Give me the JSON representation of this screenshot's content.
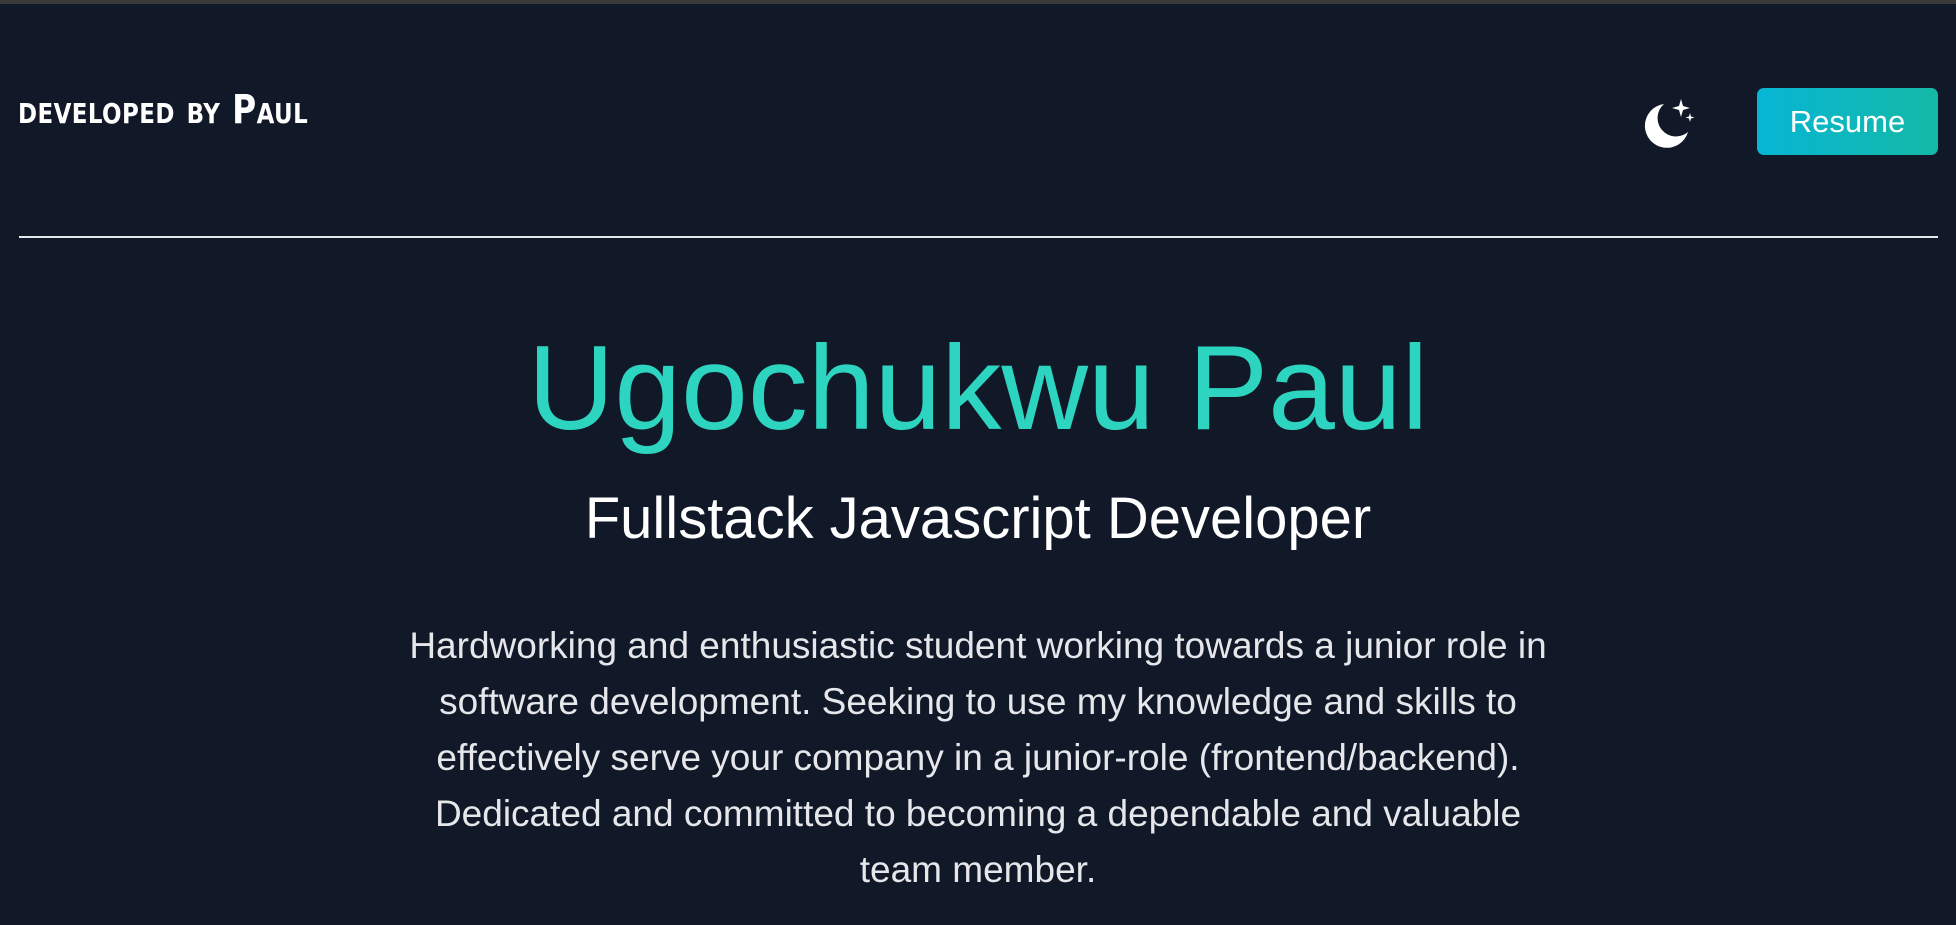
{
  "header": {
    "brand": "developed by Paul",
    "theme_toggle_icon": "moon-stars-icon",
    "resume_label": "Resume"
  },
  "hero": {
    "name": "Ugochukwu Paul",
    "role": "Fullstack Javascript Developer",
    "bio": "Hardworking and enthusiastic student working towards a junior role in software development. Seeking to use my knowledge and skills to effectively serve your company in a junior-role (frontend/backend). Dedicated and committed to becoming a dependable and valuable team member."
  },
  "colors": {
    "background": "#111827",
    "accent": "#2dd4bf",
    "button_gradient_start": "#06b6d4",
    "button_gradient_end": "#14b8a6",
    "text": "#ffffff"
  }
}
